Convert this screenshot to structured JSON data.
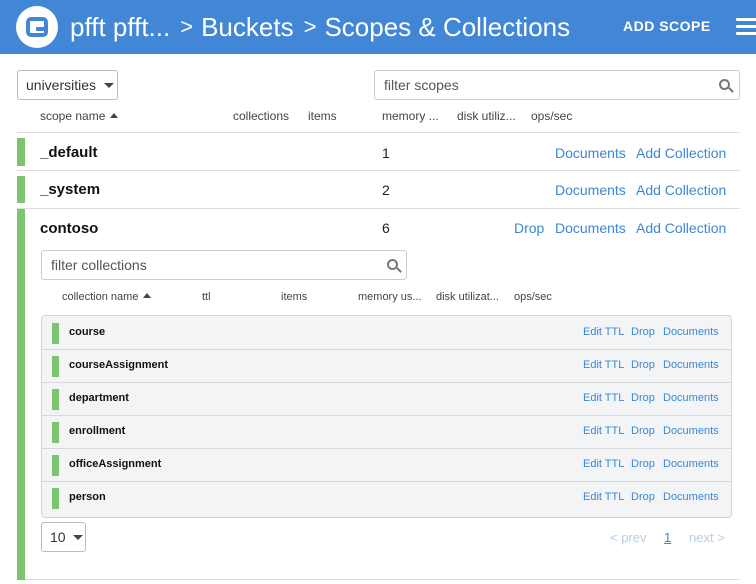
{
  "header": {
    "breadcrumb": [
      "pfft pfft...",
      "Buckets",
      "Scopes & Collections"
    ],
    "separator": ">",
    "add_scope_label": "ADD SCOPE",
    "logo_icon": "couchbase-logo-icon",
    "menu_icon": "hamburger-menu-icon",
    "color": "#4287d6"
  },
  "bucket_select": {
    "value": "universities"
  },
  "scope_filter": {
    "placeholder": "filter scopes"
  },
  "scope_columns": [
    "scope name",
    "collections",
    "items",
    "memory ...",
    "disk utiliz...",
    "ops/sec"
  ],
  "scopes": [
    {
      "name": "_default",
      "memory": "1",
      "actions": [
        "Documents",
        "Add Collection"
      ]
    },
    {
      "name": "_system",
      "memory": "2",
      "actions": [
        "Documents",
        "Add Collection"
      ]
    },
    {
      "name": "contoso",
      "memory": "6",
      "actions": [
        "Drop",
        "Documents",
        "Add Collection"
      ]
    }
  ],
  "collection_filter": {
    "placeholder": "filter collections"
  },
  "collection_columns": [
    "collection name",
    "ttl",
    "items",
    "memory us...",
    "disk utilizat...",
    "ops/sec"
  ],
  "collections": [
    {
      "name": "course",
      "actions": [
        "Edit TTL",
        "Drop",
        "Documents"
      ]
    },
    {
      "name": "courseAssignment",
      "actions": [
        "Edit TTL",
        "Drop",
        "Documents"
      ]
    },
    {
      "name": "department",
      "actions": [
        "Edit TTL",
        "Drop",
        "Documents"
      ]
    },
    {
      "name": "enrollment",
      "actions": [
        "Edit TTL",
        "Drop",
        "Documents"
      ]
    },
    {
      "name": "officeAssignment",
      "actions": [
        "Edit TTL",
        "Drop",
        "Documents"
      ]
    },
    {
      "name": "person",
      "actions": [
        "Edit TTL",
        "Drop",
        "Documents"
      ]
    }
  ],
  "pagination": {
    "page_size": "10",
    "prev": "< prev",
    "current": "1",
    "next": "next >"
  },
  "colors": {
    "accent": "#4287d6",
    "link": "#3b87d6",
    "status_green": "#7cc470"
  }
}
